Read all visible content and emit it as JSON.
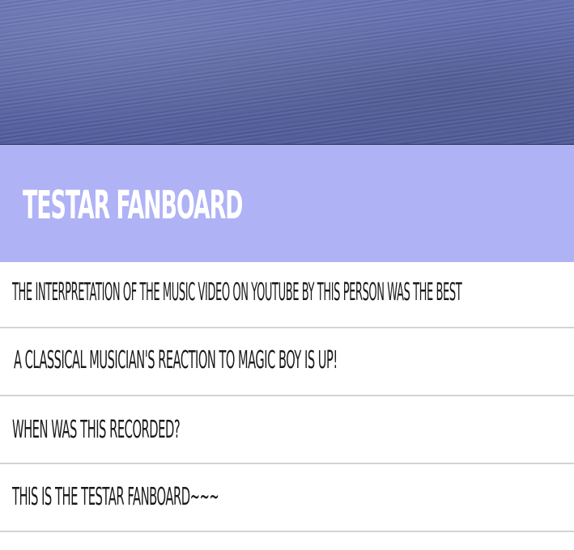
{
  "board": {
    "title": "TESTAR FANBOARD"
  },
  "posts": [
    {
      "title": "THE INTERPRETATION OF THE MUSIC VIDEO ON YOUTUBE BY THIS PERSON WAS THE BEST"
    },
    {
      "title": "A CLASSICAL MUSICIAN'S REACTION TO MAGIC BOY IS UP!"
    },
    {
      "title": "WHEN WAS THIS RECORDED?"
    },
    {
      "title": "THIS IS THE TESTAR FANBOARD~~~"
    }
  ],
  "colors": {
    "banner": "#5a66a8",
    "header": "#afb2f5",
    "title_text": "#ffffff",
    "post_text": "#1a1a1a",
    "divider": "#d3d3d3"
  }
}
